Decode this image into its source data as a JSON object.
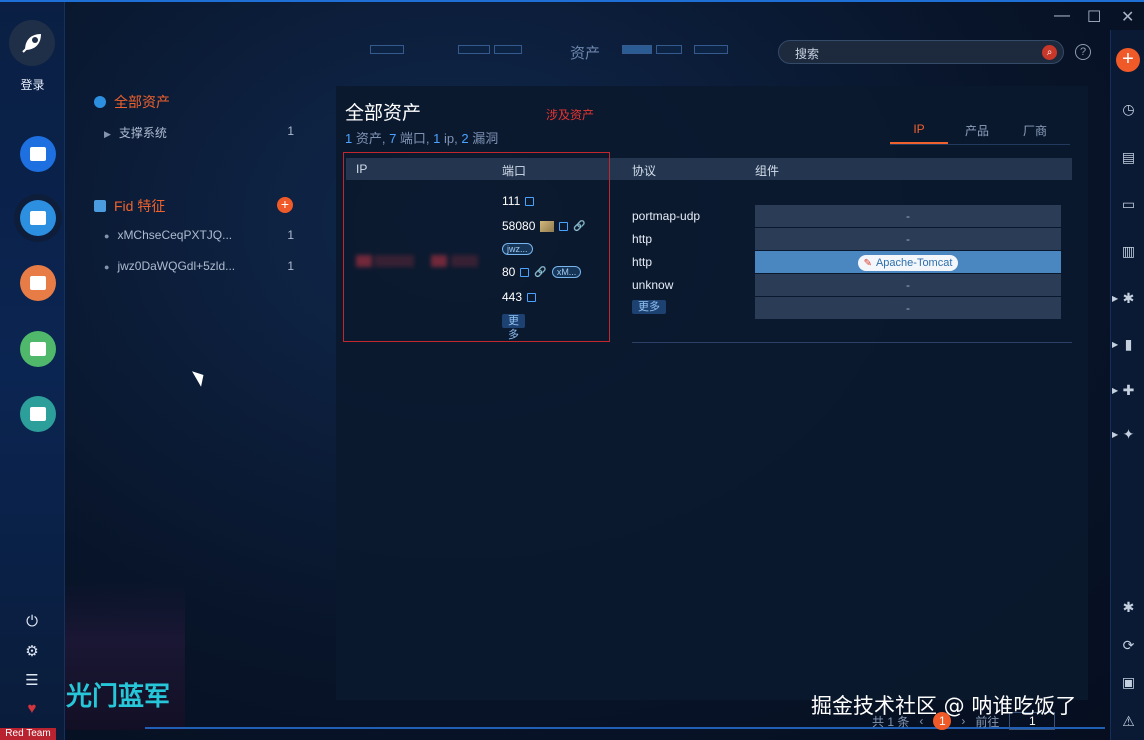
{
  "rail": {
    "login_label": "登录",
    "redteam_label": "Red Team",
    "art_text": "光门蓝军"
  },
  "tree": {
    "all_assets_label": "全部资产",
    "all_assets_child": {
      "label": "支撑系统",
      "count": "1"
    },
    "fid_label": "Fid 特征",
    "fid_add": "+",
    "fid_items": [
      {
        "label": "xMChseCeqPXTJQ...",
        "count": "1"
      },
      {
        "label": "jwz0DaWQGdl+5zld...",
        "count": "1"
      }
    ]
  },
  "header": {
    "center_title": "资产",
    "search_label": "搜索",
    "help": "?"
  },
  "window": {
    "minimize": "—",
    "maximize": "☐",
    "close": "✕"
  },
  "panel": {
    "title": "全部资产",
    "annotation": "涉及资产",
    "summary": {
      "assets": "1",
      "assets_unit": " 资产, ",
      "ports": "7",
      "ports_unit": " 端口, ",
      "ips": "1",
      "ips_unit": " ip, ",
      "vulns": "2",
      "vulns_unit": " 漏洞"
    },
    "tabs": [
      "IP",
      "产品",
      "厂商"
    ],
    "columns": [
      "IP",
      "端口",
      "协议",
      "组件"
    ],
    "ports": [
      {
        "port": "111"
      },
      {
        "port": "58080",
        "pill": "jwz..."
      },
      {
        "port": "80",
        "pill": "xM..."
      },
      {
        "port": "443"
      }
    ],
    "ports_more": "更多",
    "protocols": [
      "portmap-udp",
      "http",
      "http",
      "unknow"
    ],
    "protocols_more": "更多",
    "components": [
      "-",
      "-",
      "Apache-Tomcat",
      "-",
      "-"
    ]
  },
  "pager": {
    "total": "共 1 条",
    "prev": "‹",
    "current": "1",
    "next": "›",
    "goto_label": "前往",
    "goto_value": "1"
  },
  "watermark": "掘金技术社区 @ 呐谁吃饭了",
  "colors": {
    "accent": "#f05a28",
    "primary": "#2d8fe0",
    "highlight_row": "#4a86bf",
    "annotation": "#e8342f"
  }
}
